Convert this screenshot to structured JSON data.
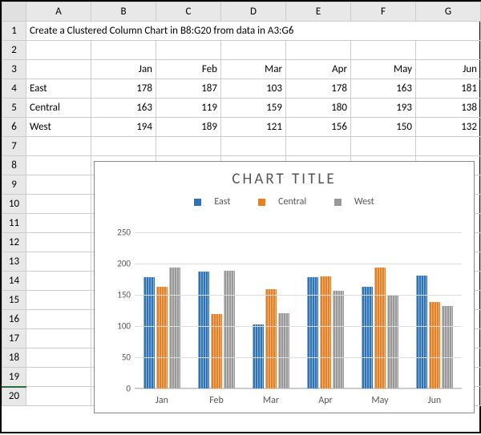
{
  "columns": [
    "A",
    "B",
    "C",
    "D",
    "E",
    "F",
    "G"
  ],
  "rows": [
    "1",
    "2",
    "3",
    "4",
    "5",
    "6",
    "7",
    "8",
    "9",
    "10",
    "11",
    "12",
    "13",
    "14",
    "15",
    "16",
    "17",
    "18",
    "19",
    "20"
  ],
  "instruction": "Create a Clustered Column Chart in B8:G20 from data in A3:G6",
  "headers": {
    "b": "Jan",
    "c": "Feb",
    "d": "Mar",
    "e": "Apr",
    "f": "May",
    "g": "Jun"
  },
  "data": {
    "east": {
      "label": "East",
      "jan": "178",
      "feb": "187",
      "mar": "103",
      "apr": "178",
      "may": "163",
      "jun": "181"
    },
    "central": {
      "label": "Central",
      "jan": "163",
      "feb": "119",
      "mar": "159",
      "apr": "180",
      "may": "193",
      "jun": "138"
    },
    "west": {
      "label": "West",
      "jan": "194",
      "feb": "189",
      "mar": "121",
      "apr": "156",
      "may": "150",
      "jun": "132"
    }
  },
  "chart_data": {
    "type": "bar",
    "title": "CHART TITLE",
    "categories": [
      "Jan",
      "Feb",
      "Mar",
      "Apr",
      "May",
      "Jun"
    ],
    "series": [
      {
        "name": "East",
        "color": "#2e74b5",
        "values": [
          178,
          187,
          103,
          178,
          163,
          181
        ]
      },
      {
        "name": "Central",
        "color": "#e67e22",
        "values": [
          163,
          119,
          159,
          180,
          193,
          138
        ]
      },
      {
        "name": "West",
        "color": "#999999",
        "values": [
          194,
          189,
          121,
          156,
          150,
          132
        ]
      }
    ],
    "ylim": [
      0,
      250
    ],
    "yticks": [
      0,
      50,
      100,
      150,
      200,
      250
    ],
    "xlabel": "",
    "ylabel": ""
  }
}
